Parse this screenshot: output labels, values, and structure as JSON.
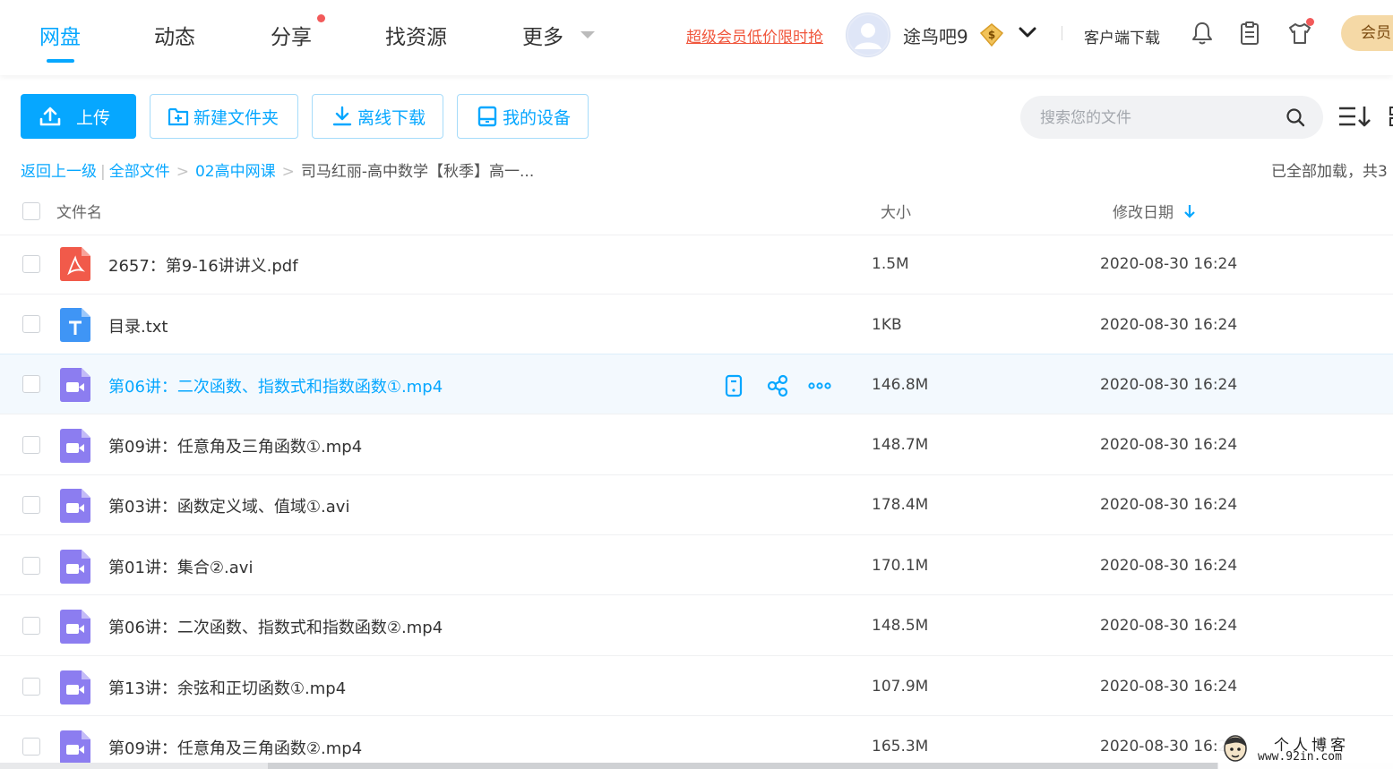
{
  "nav": {
    "tabs": [
      {
        "label": "网盘",
        "active": true
      },
      {
        "label": "动态"
      },
      {
        "label": "分享",
        "has_dot": true
      },
      {
        "label": "找资源"
      },
      {
        "label": "更多"
      }
    ],
    "promo_link": "超级会员低价限时抢",
    "username": "途鸟吧9",
    "vip_badge": "$",
    "client_download": "客户端下载",
    "member_button": "会员"
  },
  "toolbar": {
    "upload": "上传",
    "new_folder": "新建文件夹",
    "offline_download": "离线下载",
    "my_devices": "我的设备",
    "search_placeholder": "搜索您的文件"
  },
  "breadcrumb": {
    "back": "返回上一级",
    "items": [
      "全部文件",
      "02高中网课"
    ],
    "current": "司马红丽-高中数学【秋季】高一...",
    "status": "已全部加载，共3"
  },
  "table": {
    "headers": {
      "name": "文件名",
      "size": "大小",
      "date": "修改日期"
    },
    "rows": [
      {
        "name": "2657：第9-16讲讲义.pdf",
        "size": "1.5M",
        "date": "2020-08-30 16:24",
        "type": "pdf"
      },
      {
        "name": "目录.txt",
        "size": "1KB",
        "date": "2020-08-30 16:24",
        "type": "txt"
      },
      {
        "name": "第06讲：二次函数、指数式和指数函数①.mp4",
        "size": "146.8M",
        "date": "2020-08-30 16:24",
        "type": "video",
        "hover": true
      },
      {
        "name": "第09讲：任意角及三角函数①.mp4",
        "size": "148.7M",
        "date": "2020-08-30 16:24",
        "type": "video"
      },
      {
        "name": "第03讲：函数定义域、值域①.avi",
        "size": "178.4M",
        "date": "2020-08-30 16:24",
        "type": "video"
      },
      {
        "name": "第01讲：集合②.avi",
        "size": "170.1M",
        "date": "2020-08-30 16:24",
        "type": "video"
      },
      {
        "name": "第06讲：二次函数、指数式和指数函数②.mp4",
        "size": "148.5M",
        "date": "2020-08-30 16:24",
        "type": "video"
      },
      {
        "name": "第13讲：余弦和正切函数①.mp4",
        "size": "107.9M",
        "date": "2020-08-30 16:24",
        "type": "video"
      },
      {
        "name": "第09讲：任意角及三角函数②.mp4",
        "size": "165.3M",
        "date": "2020-08-30 16:2",
        "type": "video"
      }
    ]
  },
  "watermark": {
    "line1": "个人博客",
    "line2": "www.92in.com"
  },
  "colors": {
    "accent": "#06a7ff",
    "promo": "#f0553b",
    "pdf": "#f15a4a",
    "txt": "#3f95f5",
    "video": "#8c7df0"
  }
}
